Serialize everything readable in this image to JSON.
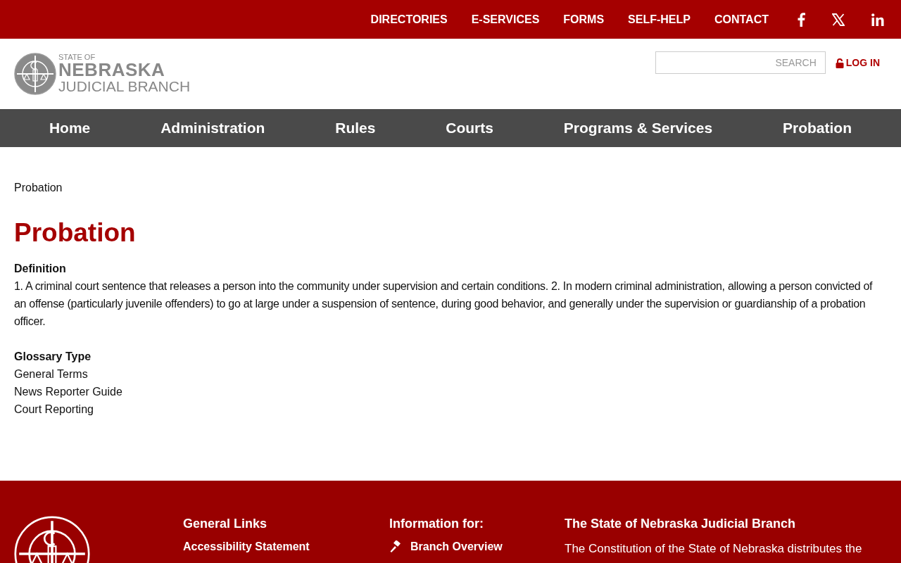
{
  "top_bar": {
    "links": [
      "DIRECTORIES",
      "E-SERVICES",
      "FORMS",
      "SELF-HELP",
      "CONTACT"
    ],
    "social": [
      {
        "kind": "facebook"
      },
      {
        "kind": "x"
      },
      {
        "kind": "linkedin"
      }
    ]
  },
  "header": {
    "logo": {
      "line_1": "STATE OF",
      "line_2": "NEBRASKA",
      "line_3": "JUDICIAL BRANCH"
    },
    "search": {
      "placeholder": "SEARCH"
    },
    "login": "LOG IN"
  },
  "nav": [
    "Home",
    "Administration",
    "Rules",
    "Courts",
    "Programs & Services",
    "Probation"
  ],
  "breadcrumb": "Probation",
  "title": "Probation",
  "definition": {
    "label": "Definition",
    "text": "1. A criminal court sentence that releases a person into the community under supervision and certain conditions. 2. In modern criminal administration, allowing a person convicted of an offense (particularly juvenile offenders) to go at large under a suspension of sentence, during good behavior, and generally under the supervision or guardianship of a probation officer."
  },
  "glossary_type": {
    "label": "Glossary Type",
    "items": [
      "General Terms",
      "News Reporter Guide",
      "Court Reporting"
    ]
  },
  "footer": {
    "columns": [
      {
        "heading": "General Links",
        "links": [
          {
            "label": "Accessibility Statement"
          }
        ]
      },
      {
        "heading": "Information for:",
        "links": [
          {
            "label": "Branch Overview",
            "kind": "gavel"
          }
        ]
      },
      {
        "heading": "The State of Nebraska Judicial Branch",
        "text": "The Constitution of the State of Nebraska distributes the"
      }
    ]
  }
}
